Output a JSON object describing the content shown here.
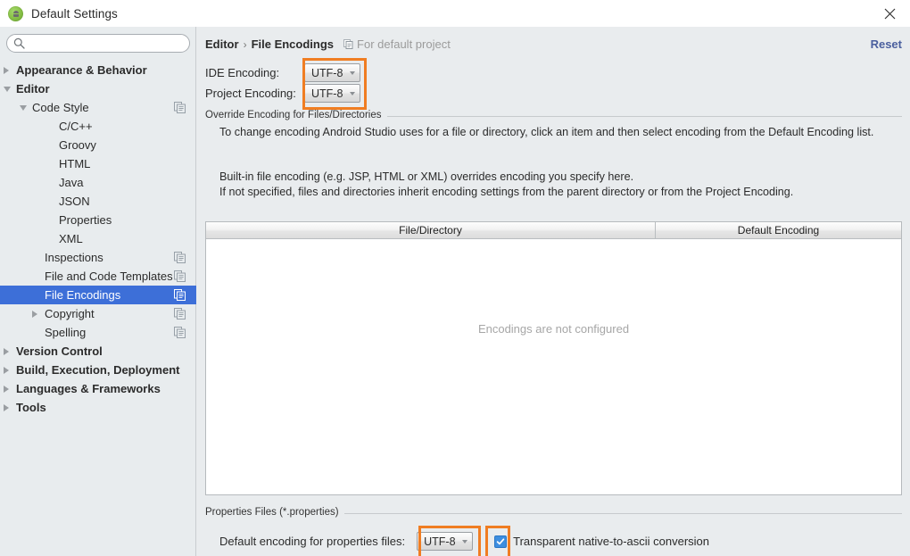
{
  "window": {
    "title": "Default Settings",
    "app_icon": "android-studio-icon",
    "close_icon": "close-icon"
  },
  "sidebar": {
    "search": {
      "value": "",
      "placeholder": "",
      "icon": "search-icon"
    },
    "items": [
      {
        "label": "Appearance & Behavior",
        "indent": 10,
        "arrow": "right",
        "bold": true,
        "copy": false,
        "selected": false
      },
      {
        "label": "Editor",
        "indent": 10,
        "arrow": "down",
        "bold": true,
        "copy": false,
        "selected": false
      },
      {
        "label": "Code Style",
        "indent": 28,
        "arrow": "down",
        "bold": false,
        "copy": true,
        "selected": false
      },
      {
        "label": "C/C++",
        "indent": 58,
        "arrow": "none",
        "bold": false,
        "copy": false,
        "selected": false
      },
      {
        "label": "Groovy",
        "indent": 58,
        "arrow": "none",
        "bold": false,
        "copy": false,
        "selected": false
      },
      {
        "label": "HTML",
        "indent": 58,
        "arrow": "none",
        "bold": false,
        "copy": false,
        "selected": false
      },
      {
        "label": "Java",
        "indent": 58,
        "arrow": "none",
        "bold": false,
        "copy": false,
        "selected": false
      },
      {
        "label": "JSON",
        "indent": 58,
        "arrow": "none",
        "bold": false,
        "copy": false,
        "selected": false
      },
      {
        "label": "Properties",
        "indent": 58,
        "arrow": "none",
        "bold": false,
        "copy": false,
        "selected": false
      },
      {
        "label": "XML",
        "indent": 58,
        "arrow": "none",
        "bold": false,
        "copy": false,
        "selected": false
      },
      {
        "label": "Inspections",
        "indent": 42,
        "arrow": "none",
        "bold": false,
        "copy": true,
        "selected": false
      },
      {
        "label": "File and Code Templates",
        "indent": 42,
        "arrow": "none",
        "bold": false,
        "copy": true,
        "selected": false
      },
      {
        "label": "File Encodings",
        "indent": 42,
        "arrow": "none",
        "bold": false,
        "copy": true,
        "selected": true
      },
      {
        "label": "Copyright",
        "indent": 42,
        "arrow": "right",
        "bold": false,
        "copy": true,
        "selected": false
      },
      {
        "label": "Spelling",
        "indent": 42,
        "arrow": "none",
        "bold": false,
        "copy": true,
        "selected": false
      },
      {
        "label": "Version Control",
        "indent": 10,
        "arrow": "right",
        "bold": true,
        "copy": false,
        "selected": false
      },
      {
        "label": "Build, Execution, Deployment",
        "indent": 10,
        "arrow": "right",
        "bold": true,
        "copy": false,
        "selected": false
      },
      {
        "label": "Languages & Frameworks",
        "indent": 10,
        "arrow": "right",
        "bold": true,
        "copy": false,
        "selected": false
      },
      {
        "label": "Tools",
        "indent": 10,
        "arrow": "right",
        "bold": true,
        "copy": false,
        "selected": false
      }
    ]
  },
  "content": {
    "breadcrumb": {
      "root": "Editor",
      "separator": "›",
      "leaf": "File Encodings",
      "note": "For default project",
      "note_icon": "copy-icon"
    },
    "reset_label": "Reset",
    "ide_encoding": {
      "label": "IDE Encoding:",
      "value": "UTF-8"
    },
    "project_encoding": {
      "label": "Project Encoding:",
      "value": "UTF-8"
    },
    "override_group": {
      "title": "Override Encoding for Files/Directories",
      "paragraph1": "To change encoding Android Studio uses for a file or directory, click an item and then select encoding from the Default Encoding list.",
      "paragraph2": "Built-in file encoding (e.g. JSP, HTML or XML) overrides encoding you specify here.",
      "paragraph3": "If not specified, files and directories inherit encoding settings from the parent directory or from the Project Encoding."
    },
    "table": {
      "columns": [
        "File/Directory",
        "Default Encoding"
      ],
      "rows": [],
      "empty_text": "Encodings are not configured"
    },
    "properties_group": {
      "title": "Properties Files (*.properties)",
      "default_encoding_label": "Default encoding for properties files:",
      "default_encoding_value": "UTF-8",
      "transparent_label": "Transparent native-to-ascii conversion",
      "transparent_checked": true
    }
  },
  "colors": {
    "highlight": "#f07d22",
    "selection": "#3d6fd8",
    "link": "#4a5f9e",
    "checkbox": "#3d8ee0"
  }
}
